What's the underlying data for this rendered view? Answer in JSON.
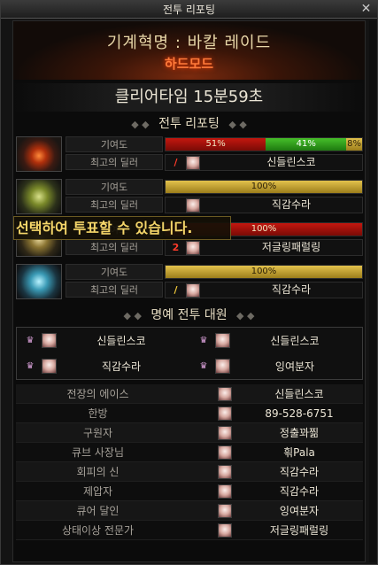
{
  "window": {
    "title": "전투 리포팅",
    "close_label": "✕"
  },
  "header": {
    "raid_name": "기계혁명 : 바칼 레이드",
    "difficulty": "하드모드",
    "clear_time": "클리어타임 15분59초"
  },
  "battle_report": {
    "heading": "전투 리포팅",
    "contribution_label": "기여도",
    "best_dealer_label": "최고의 딜러",
    "fighters": [
      {
        "segments": [
          {
            "label": "51%",
            "value": 51,
            "color": "red"
          },
          {
            "label": "41%",
            "value": 41,
            "color": "green"
          },
          {
            "label": "8%",
            "value": 8,
            "color": "gold"
          }
        ],
        "dealer_icon": "fire-slash-icon",
        "dealer_icon_glyph": "/",
        "dealer_icon_color": "#ff3b2a",
        "dealer_name": "신들린스코"
      },
      {
        "segments": [
          {
            "label": "100%",
            "value": 100,
            "color": "gold"
          }
        ],
        "dealer_icon": "job-icon",
        "dealer_icon_glyph": "",
        "dealer_icon_color": "#d8c060",
        "dealer_name": "직감수라"
      },
      {
        "segments": [
          {
            "label": "100%",
            "value": 100,
            "color": "red"
          }
        ],
        "dealer_icon": "number-two-icon",
        "dealer_icon_glyph": "2",
        "dealer_icon_color": "#ff3b2a",
        "dealer_name": "저글링패럴링"
      },
      {
        "segments": [
          {
            "label": "100%",
            "value": 100,
            "color": "gold"
          }
        ],
        "dealer_icon": "gold-slash-icon",
        "dealer_icon_glyph": "/",
        "dealer_icon_color": "#f0c83a",
        "dealer_name": "직감수라"
      }
    ]
  },
  "tooltip": {
    "text": "선택하여 투표할 수 있습니다."
  },
  "honor": {
    "heading": "명예 전투 대원",
    "voters": [
      "신들린스코",
      "신들린스코",
      "직감수라",
      "잉여분자"
    ]
  },
  "awards": [
    {
      "title": "전장의 에이스",
      "name": "신들린스코"
    },
    {
      "title": "한방",
      "name": "89-528-6751"
    },
    {
      "title": "구원자",
      "name": "정출꽈찖"
    },
    {
      "title": "큐브 사장님",
      "name": "흮Pala"
    },
    {
      "title": "회피의 신",
      "name": "직감수라"
    },
    {
      "title": "제압자",
      "name": "직감수라"
    },
    {
      "title": "큐어 달인",
      "name": "잉여분자"
    },
    {
      "title": "상태이상 전문가",
      "name": "저글링패럴링"
    }
  ],
  "colors": {
    "red": "#c4170f",
    "green": "#46c02a",
    "gold": "#e3c24c",
    "hard_mode": "#ff7a3a",
    "tooltip_text": "#f5d66a"
  }
}
